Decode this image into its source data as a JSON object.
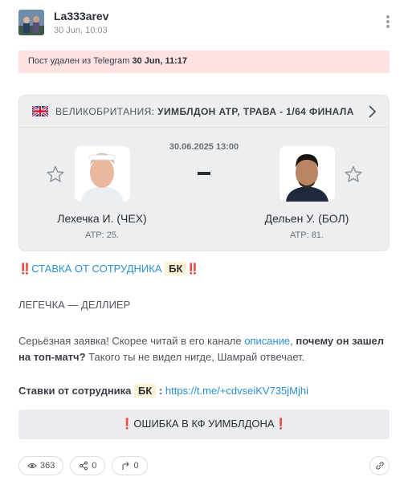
{
  "post": {
    "author": "La333arev",
    "date": "30 Jun, 10:03"
  },
  "deleted_notice": {
    "prefix": "Пост удален из Telegram",
    "date": "30 Jun, 11:17"
  },
  "match": {
    "country": "ВЕЛИКОБРИТАНИЯ:",
    "tournament": "УИМБЛДОН ATP, ТРАВА - 1/64 ФИНАЛА",
    "datetime": "30.06.2025 13:00",
    "score_separator": "-",
    "player1": {
      "name": "Лехечка И. (ЧЕХ)",
      "rank": "ATP: 25."
    },
    "player2": {
      "name": "Дельен У. (БОЛ)",
      "rank": "ATP: 81."
    }
  },
  "content": {
    "heading_excl_left": "‼️",
    "heading_link": "СТАВКА ОТ СОТРУДНИКА",
    "bk": "БК",
    "heading_excl_right": "‼️",
    "matchup": "ЛЕГЕЧКА — ДЕЛЛИЕР",
    "p1_text": "Серьёзная заявка! Скорее читай в его канале",
    "p1_link": "описание",
    "p1_bold": "почему он зашел на топ-матч?",
    "p1_tail": "Такого ты не видел нигде, Шамрай отвечает.",
    "bets_label": "Ставки от сотрудника",
    "bets_bk": "БК",
    "bets_colon": ":",
    "bets_url": "https://t.me/+cdvseiKV735jMjhi",
    "error_button": "❗ОШИБКА В КФ УИМБЛДОНА❗"
  },
  "stats": {
    "views": "363",
    "shares": "0",
    "forwards": "0"
  },
  "colors": {
    "deleted_bg": "#fde1e3",
    "link": "#2b8fd6",
    "bk_bg": "#fdf2d3",
    "card_bg": "#edeef0"
  }
}
